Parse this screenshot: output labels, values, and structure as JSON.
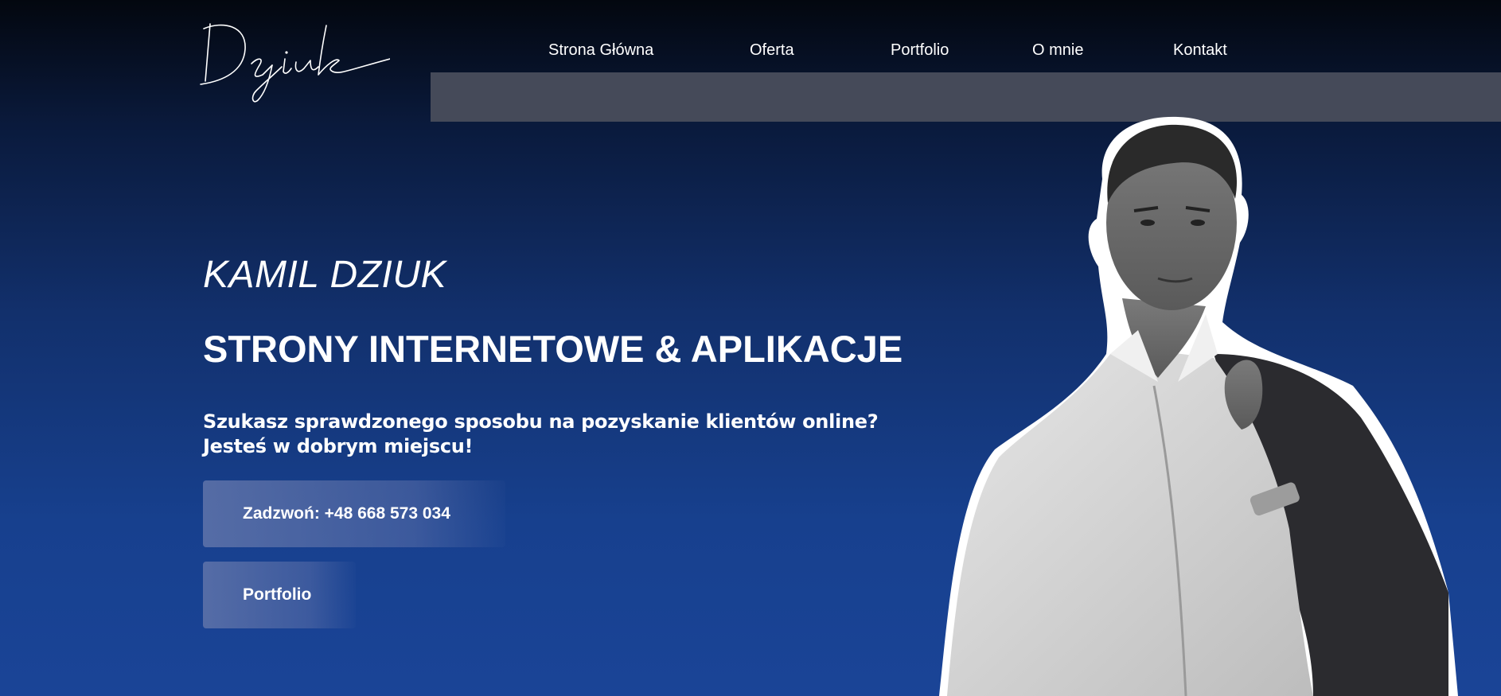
{
  "brand": {
    "logo_text": "Dziuk"
  },
  "nav": {
    "items": [
      {
        "label": "Strona Główna"
      },
      {
        "label": "Oferta"
      },
      {
        "label": "Portfolio"
      },
      {
        "label": "O mnie"
      },
      {
        "label": "Kontakt"
      }
    ]
  },
  "hero": {
    "name": "KAMIL DZIUK",
    "title": "STRONY INTERNETOWE & APLIKACJE",
    "subtitle_line1": "Szukasz sprawdzonego sposobu na pozyskanie klientów online?",
    "subtitle_line2": "Jesteś w dobrym miejscu!",
    "call_button": "Zadzwoń: +48 668 573 034",
    "portfolio_button": "Portfolio"
  },
  "colors": {
    "background_top": "#03070f",
    "background_bottom": "#1a4497",
    "band": "#454a59",
    "button": "#6074aa"
  }
}
